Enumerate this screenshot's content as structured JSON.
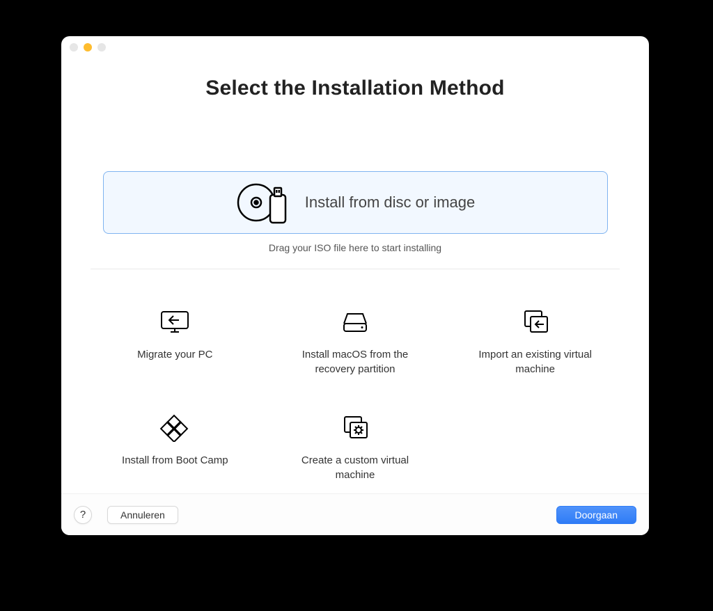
{
  "window": {
    "title": "Select the Installation Method",
    "hint": "Drag your ISO file here to start installing"
  },
  "primary_option": {
    "label": "Install from disc or image"
  },
  "options": [
    {
      "id": "migrate",
      "label": "Migrate your PC"
    },
    {
      "id": "macos",
      "label": "Install macOS from the recovery partition"
    },
    {
      "id": "import",
      "label": "Import an existing virtual machine"
    },
    {
      "id": "bootcamp",
      "label": "Install from Boot Camp"
    },
    {
      "id": "custom",
      "label": "Create a custom virtual machine"
    }
  ],
  "footer": {
    "help_symbol": "?",
    "cancel_label": "Annuleren",
    "continue_label": "Doorgaan"
  }
}
